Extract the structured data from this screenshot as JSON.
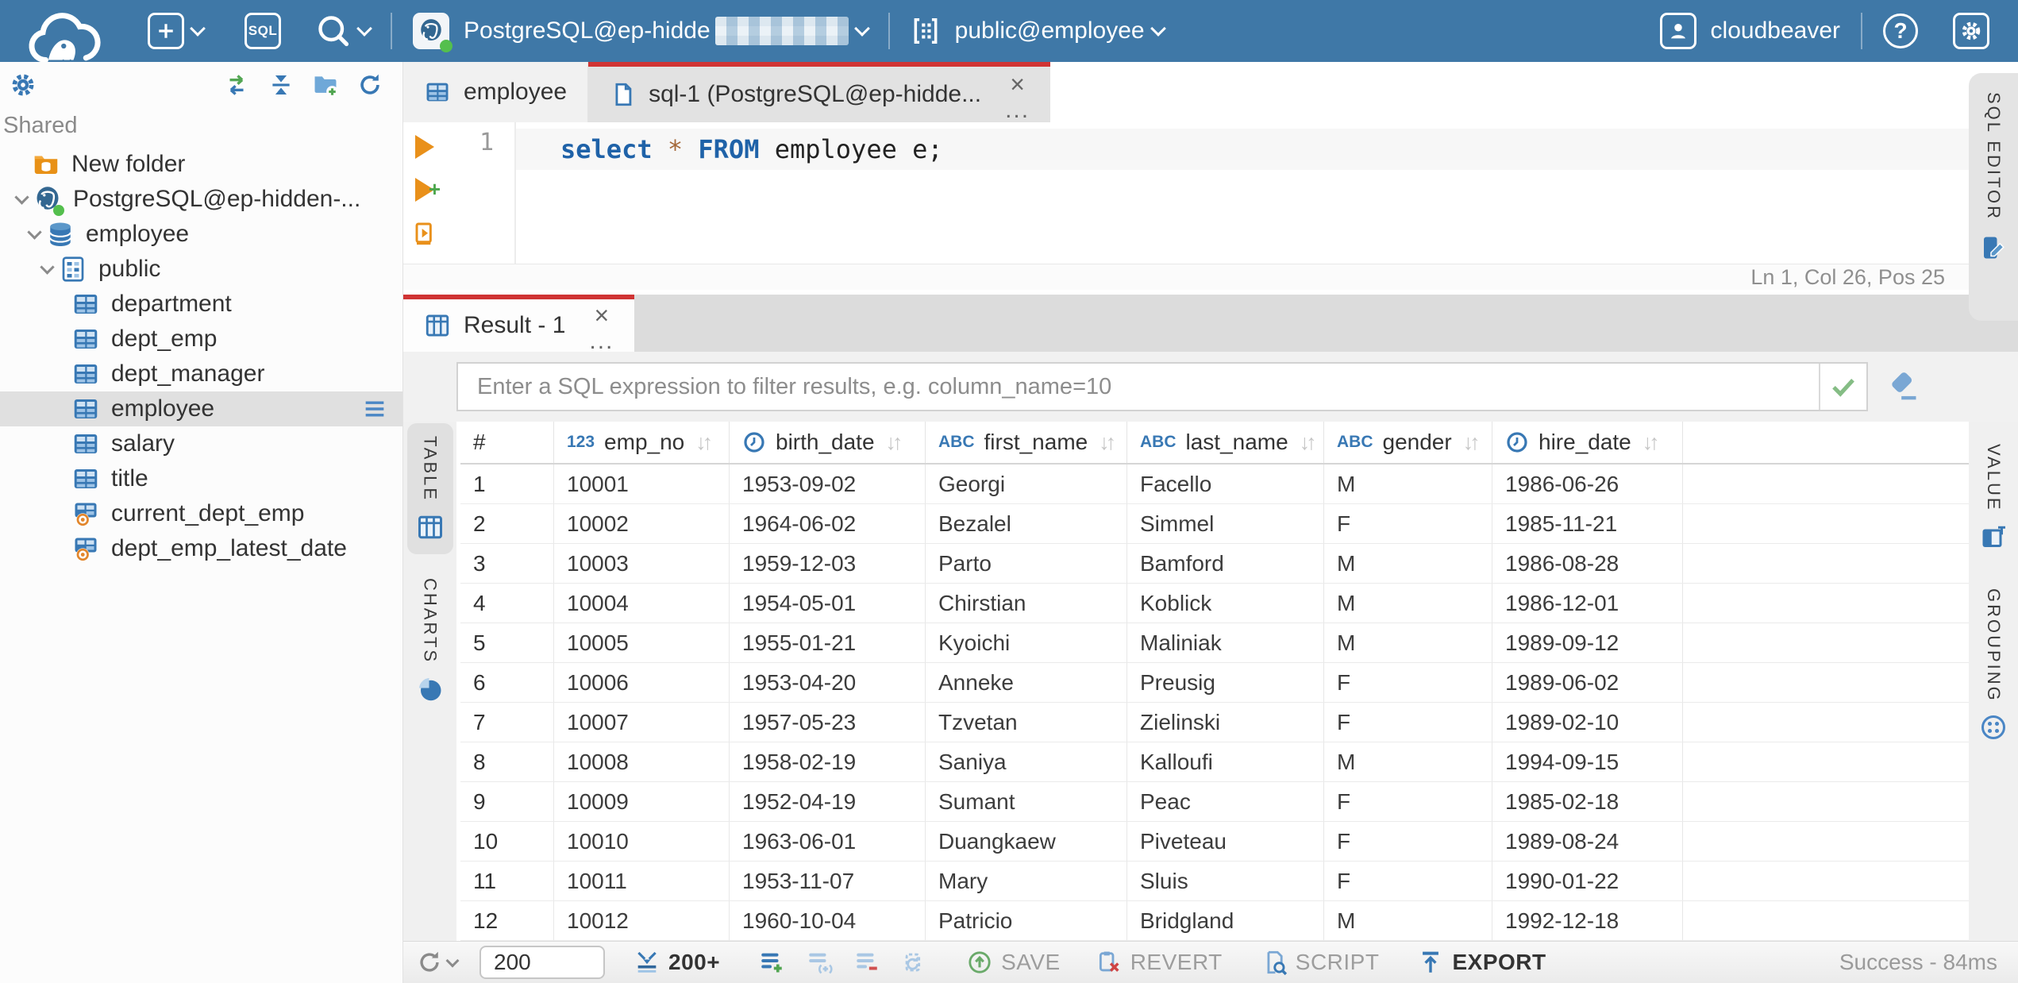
{
  "topbar": {
    "sql_button": "SQL",
    "connection_label": "PostgreSQL@ep-hidde",
    "schema_label": "public@employee",
    "username": "cloudbeaver",
    "help_glyph": "?"
  },
  "sidebar": {
    "section_label": "Shared",
    "tree": [
      {
        "label": "New folder",
        "icon": "folder-db",
        "depth": 1,
        "expanded": false,
        "selected": false
      },
      {
        "label": "PostgreSQL@ep-hidden-...",
        "icon": "postgres",
        "depth": 0,
        "expanded": true,
        "selected": false
      },
      {
        "label": "employee",
        "icon": "database",
        "depth": 1,
        "expanded": true,
        "selected": false
      },
      {
        "label": "public",
        "icon": "schema",
        "depth": 2,
        "expanded": true,
        "selected": false
      },
      {
        "label": "department",
        "icon": "table",
        "depth": 3,
        "expanded": false,
        "selected": false
      },
      {
        "label": "dept_emp",
        "icon": "table",
        "depth": 3,
        "expanded": false,
        "selected": false
      },
      {
        "label": "dept_manager",
        "icon": "table",
        "depth": 3,
        "expanded": false,
        "selected": false
      },
      {
        "label": "employee",
        "icon": "table",
        "depth": 3,
        "expanded": false,
        "selected": true
      },
      {
        "label": "salary",
        "icon": "table",
        "depth": 3,
        "expanded": false,
        "selected": false
      },
      {
        "label": "title",
        "icon": "table",
        "depth": 3,
        "expanded": false,
        "selected": false
      },
      {
        "label": "current_dept_emp",
        "icon": "view",
        "depth": 3,
        "expanded": false,
        "selected": false
      },
      {
        "label": "dept_emp_latest_date",
        "icon": "view",
        "depth": 3,
        "expanded": false,
        "selected": false
      }
    ]
  },
  "editor": {
    "tab_table": "employee",
    "tab_sql": "sql-1 (PostgreSQL@ep-hidde...",
    "line_number": "1",
    "code": [
      {
        "text": "select",
        "type": "keyword"
      },
      {
        "text": " ",
        "type": "plain"
      },
      {
        "text": "*",
        "type": "operator"
      },
      {
        "text": " ",
        "type": "plain"
      },
      {
        "text": "FROM",
        "type": "keyword"
      },
      {
        "text": " employee e;",
        "type": "plain"
      }
    ],
    "status": "Ln 1, Col 26, Pos 25",
    "side_tab": "SQL EDITOR"
  },
  "result": {
    "tab_label": "Result - 1",
    "filter_placeholder": "Enter a SQL expression to filter results, e.g. column_name=10",
    "left_tabs": [
      {
        "label": "TABLE",
        "icon": "grid",
        "selected": true
      },
      {
        "label": "CHARTS",
        "icon": "pie",
        "selected": false
      }
    ],
    "right_tabs": [
      {
        "label": "VALUE",
        "icon": "value"
      },
      {
        "label": "GROUPING",
        "icon": "grouping"
      }
    ],
    "grid": {
      "columns": [
        {
          "name": "#",
          "type": ""
        },
        {
          "name": "emp_no",
          "type": "number"
        },
        {
          "name": "birth_date",
          "type": "date"
        },
        {
          "name": "first_name",
          "type": "string"
        },
        {
          "name": "last_name",
          "type": "string"
        },
        {
          "name": "gender",
          "type": "string"
        },
        {
          "name": "hire_date",
          "type": "date"
        }
      ],
      "rows": [
        [
          "1",
          "10001",
          "1953-09-02",
          "Georgi",
          "Facello",
          "M",
          "1986-06-26"
        ],
        [
          "2",
          "10002",
          "1964-06-02",
          "Bezalel",
          "Simmel",
          "F",
          "1985-11-21"
        ],
        [
          "3",
          "10003",
          "1959-12-03",
          "Parto",
          "Bamford",
          "M",
          "1986-08-28"
        ],
        [
          "4",
          "10004",
          "1954-05-01",
          "Chirstian",
          "Koblick",
          "M",
          "1986-12-01"
        ],
        [
          "5",
          "10005",
          "1955-01-21",
          "Kyoichi",
          "Maliniak",
          "M",
          "1989-09-12"
        ],
        [
          "6",
          "10006",
          "1953-04-20",
          "Anneke",
          "Preusig",
          "F",
          "1989-06-02"
        ],
        [
          "7",
          "10007",
          "1957-05-23",
          "Tzvetan",
          "Zielinski",
          "F",
          "1989-02-10"
        ],
        [
          "8",
          "10008",
          "1958-02-19",
          "Saniya",
          "Kalloufi",
          "M",
          "1994-09-15"
        ],
        [
          "9",
          "10009",
          "1952-04-19",
          "Sumant",
          "Peac",
          "F",
          "1985-02-18"
        ],
        [
          "10",
          "10010",
          "1963-06-01",
          "Duangkaew",
          "Piveteau",
          "F",
          "1989-08-24"
        ],
        [
          "11",
          "10011",
          "1953-11-07",
          "Mary",
          "Sluis",
          "F",
          "1990-01-22"
        ],
        [
          "12",
          "10012",
          "1960-10-04",
          "Patricio",
          "Bridgland",
          "M",
          "1992-12-18"
        ]
      ]
    },
    "toolbar": {
      "fetch_size": "200",
      "fetch_more_label": "200+",
      "save_label": "SAVE",
      "revert_label": "REVERT",
      "script_label": "SCRIPT",
      "export_label": "EXPORT",
      "status": "Success - 84ms"
    }
  },
  "colors": {
    "topbar": "#3f78a7",
    "accent_red": "#d03434",
    "primary_blue": "#3878b4",
    "selected_gray": "#e0e0e0",
    "success_text": "#9a9a9a"
  }
}
